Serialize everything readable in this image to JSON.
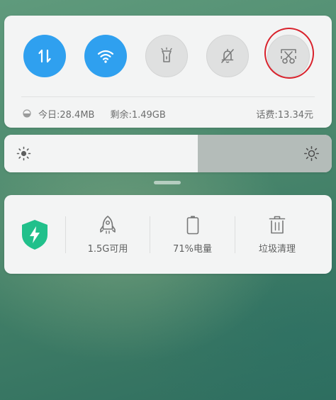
{
  "quick_toggles": [
    {
      "name": "mobile-data",
      "icon": "data-transfer-icon",
      "state": "on"
    },
    {
      "name": "wifi",
      "icon": "wifi-icon",
      "state": "on"
    },
    {
      "name": "flashlight",
      "icon": "flashlight-icon",
      "state": "off"
    },
    {
      "name": "mute",
      "icon": "bell-off-icon",
      "state": "off"
    },
    {
      "name": "screenshot",
      "icon": "screenshot-scissors-icon",
      "state": "off"
    }
  ],
  "data_usage": {
    "today": "今日:28.4MB",
    "remaining": "剩余:1.49GB",
    "balance": "话费:13.34元"
  },
  "brightness": {
    "level": 0.59
  },
  "tools": [
    {
      "icon": "security-shield-icon",
      "label": ""
    },
    {
      "icon": "rocket-icon",
      "label": "1.5G可用"
    },
    {
      "icon": "battery-icon",
      "label": "71%电量"
    },
    {
      "icon": "trash-icon",
      "label": "垃圾清理"
    }
  ],
  "colors": {
    "accent": "#2fa0ef",
    "shield": "#21c08b",
    "annotation": "#d9232d"
  }
}
